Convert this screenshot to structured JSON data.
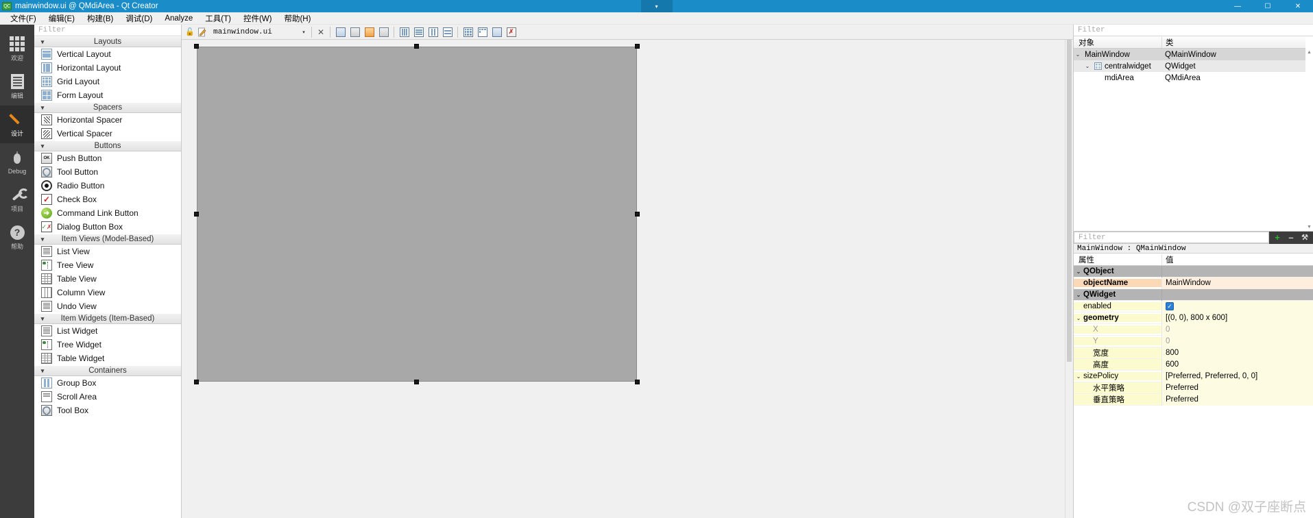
{
  "titlebar": {
    "icon": "qt-creator-logo-icon",
    "title": "mainwindow.ui @ QMdiArea - Qt Creator",
    "dropdown_glyph": "▾",
    "minimize": "—",
    "maximize": "☐",
    "close": "✕"
  },
  "menubar": {
    "items": [
      {
        "label": "文件(F)"
      },
      {
        "label": "编辑(E)"
      },
      {
        "label": "构建(B)"
      },
      {
        "label": "调试(D)"
      },
      {
        "label": "Analyze"
      },
      {
        "label": "工具(T)"
      },
      {
        "label": "控件(W)"
      },
      {
        "label": "帮助(H)"
      }
    ]
  },
  "modebar": {
    "items": [
      {
        "label": "欢迎",
        "icon": "grid-icon",
        "active": false
      },
      {
        "label": "编辑",
        "icon": "document-icon",
        "active": false
      },
      {
        "label": "设计",
        "icon": "pencil-icon",
        "active": true
      },
      {
        "label": "Debug",
        "icon": "bug-icon",
        "active": false
      },
      {
        "label": "项目",
        "icon": "wrench-icon",
        "active": false
      },
      {
        "label": "帮助",
        "icon": "question-mark-icon",
        "active": false
      }
    ]
  },
  "widgetbox": {
    "filter_placeholder": "Filter",
    "groups": [
      {
        "title": "Layouts",
        "items": [
          {
            "label": "Vertical Layout",
            "icon": "vertical-layout-icon"
          },
          {
            "label": "Horizontal Layout",
            "icon": "horizontal-layout-icon"
          },
          {
            "label": "Grid Layout",
            "icon": "grid-layout-icon"
          },
          {
            "label": "Form Layout",
            "icon": "form-layout-icon"
          }
        ]
      },
      {
        "title": "Spacers",
        "items": [
          {
            "label": "Horizontal Spacer",
            "icon": "horizontal-spacer-icon"
          },
          {
            "label": "Vertical Spacer",
            "icon": "vertical-spacer-icon"
          }
        ]
      },
      {
        "title": "Buttons",
        "items": [
          {
            "label": "Push Button",
            "icon": "push-button-icon"
          },
          {
            "label": "Tool Button",
            "icon": "tool-button-icon"
          },
          {
            "label": "Radio Button",
            "icon": "radio-button-icon"
          },
          {
            "label": "Check Box",
            "icon": "check-box-icon"
          },
          {
            "label": "Command Link Button",
            "icon": "command-link-icon"
          },
          {
            "label": "Dialog Button Box",
            "icon": "dialog-button-box-icon"
          }
        ]
      },
      {
        "title": "Item Views (Model-Based)",
        "items": [
          {
            "label": "List View",
            "icon": "list-view-icon"
          },
          {
            "label": "Tree View",
            "icon": "tree-view-icon"
          },
          {
            "label": "Table View",
            "icon": "table-view-icon"
          },
          {
            "label": "Column View",
            "icon": "column-view-icon"
          },
          {
            "label": "Undo View",
            "icon": "undo-view-icon"
          }
        ]
      },
      {
        "title": "Item Widgets (Item-Based)",
        "items": [
          {
            "label": "List Widget",
            "icon": "list-widget-icon"
          },
          {
            "label": "Tree Widget",
            "icon": "tree-widget-icon"
          },
          {
            "label": "Table Widget",
            "icon": "table-widget-icon"
          }
        ]
      },
      {
        "title": "Containers",
        "items": [
          {
            "label": "Group Box",
            "icon": "group-box-icon"
          },
          {
            "label": "Scroll Area",
            "icon": "scroll-area-icon"
          },
          {
            "label": "Tool Box",
            "icon": "tool-box-icon"
          }
        ]
      }
    ]
  },
  "editor_toolbar": {
    "lock_icon": "lock-open-icon",
    "file_icon": "ui-file-icon",
    "filename": "mainwindow.ui",
    "dropdown_glyph": "▾",
    "close_glyph": "✕",
    "buttons": [
      {
        "name": "edit-widgets-button",
        "icon": "edit-widgets-icon"
      },
      {
        "name": "edit-signals-slots-button",
        "icon": "signals-slots-icon"
      },
      {
        "name": "edit-buddies-button",
        "icon": "buddies-icon"
      },
      {
        "name": "edit-tab-order-button",
        "icon": "tab-order-icon"
      },
      {
        "name": "layout-horizontally-button",
        "icon": "layout-horizontal-icon"
      },
      {
        "name": "layout-vertically-button",
        "icon": "layout-vertical-icon"
      },
      {
        "name": "layout-splitter-horizontal-button",
        "icon": "splitter-horizontal-icon"
      },
      {
        "name": "layout-splitter-vertical-button",
        "icon": "splitter-vertical-icon"
      },
      {
        "name": "layout-in-grid-button",
        "icon": "layout-grid-icon"
      },
      {
        "name": "layout-in-form-button",
        "icon": "layout-form-icon"
      },
      {
        "name": "break-layout-button",
        "icon": "break-layout-icon"
      }
    ]
  },
  "canvas": {
    "form_name": "mainwindow-form",
    "background_color": "#a8a8a8"
  },
  "objecttree": {
    "filter_placeholder": "Filter",
    "columns": [
      "对象",
      "类"
    ],
    "rows": [
      {
        "indent": 0,
        "chevron": "⌄",
        "icon": "",
        "name": "MainWindow",
        "class": "QMainWindow",
        "selected": true
      },
      {
        "indent": 1,
        "chevron": "⌄",
        "icon": "widget-icon",
        "name": "centralwidget",
        "class": "QWidget",
        "selected": false
      },
      {
        "indent": 2,
        "chevron": "",
        "icon": "",
        "name": "mdiArea",
        "class": "QMdiArea",
        "selected": false
      }
    ],
    "scroll_up_glyph": "▲",
    "scroll_down_glyph": "▼"
  },
  "propertyeditor": {
    "filter_placeholder": "Filter",
    "add_glyph": "+",
    "remove_glyph": "–",
    "config_glyph": "⚒",
    "object_line": "MainWindow : QMainWindow",
    "columns": [
      "属性",
      "值"
    ],
    "rows": [
      {
        "type": "group",
        "chevron": "⌄",
        "key": "QObject",
        "value": ""
      },
      {
        "type": "peach",
        "indent": 1,
        "key": "objectName",
        "value": "MainWindow",
        "bold": true
      },
      {
        "type": "group",
        "chevron": "⌄",
        "key": "QWidget",
        "value": ""
      },
      {
        "type": "yellow",
        "indent": 1,
        "key": "enabled",
        "value": "",
        "control": "checkbox",
        "checked": true
      },
      {
        "type": "yellow",
        "chevron": "⌄",
        "key": "geometry",
        "value": "[(0, 0), 800 x 600]",
        "bold": true
      },
      {
        "type": "yellow",
        "indent": 2,
        "key": "X",
        "value": "0",
        "muted": true
      },
      {
        "type": "yellow",
        "indent": 2,
        "key": "Y",
        "value": "0",
        "muted": true
      },
      {
        "type": "yellow",
        "indent": 2,
        "key": "宽度",
        "value": "800"
      },
      {
        "type": "yellow",
        "indent": 2,
        "key": "高度",
        "value": "600"
      },
      {
        "type": "yellow",
        "chevron": "⌄",
        "key": "sizePolicy",
        "value": "[Preferred, Preferred, 0, 0]"
      },
      {
        "type": "yellow",
        "indent": 2,
        "key": "水平策略",
        "value": "Preferred"
      },
      {
        "type": "yellow",
        "indent": 2,
        "key": "垂直策略",
        "value": "Preferred"
      }
    ]
  },
  "watermark": {
    "text": "CSDN @双子座断点"
  },
  "colors": {
    "titlebar": "#1a8cc8",
    "modebar": "#3c3c3c",
    "accent_orange": "#e8871a",
    "canvas_widget": "#a8a8a8",
    "property_peach": "#fbd9b6",
    "property_yellow": "#fcfbd0",
    "group_row": "#b4b4b4"
  }
}
